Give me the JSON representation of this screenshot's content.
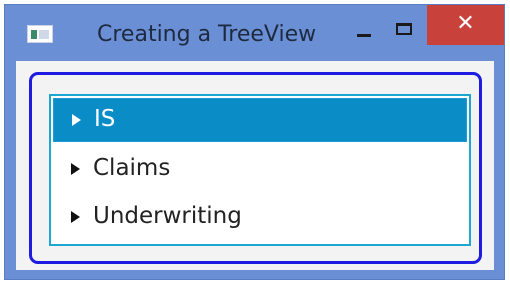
{
  "window": {
    "title": "Creating a TreeView",
    "close_glyph": "✕",
    "icons": {
      "app": "window-app-icon",
      "minimize": "minimize-icon",
      "maximize": "maximize-icon",
      "close": "close-icon"
    }
  },
  "tree": {
    "items": [
      {
        "label": "IS",
        "selected": true,
        "expander_icon": "expand-arrow-icon"
      },
      {
        "label": "Claims",
        "selected": false,
        "expander_icon": "expand-arrow-icon"
      },
      {
        "label": "Underwriting",
        "selected": false,
        "expander_icon": "expand-arrow-icon"
      }
    ]
  },
  "colors": {
    "window_frame": "#6b8fd4",
    "close_button": "#c8413a",
    "selection": "#0a8cc6",
    "focus_outline": "#1d1ce0",
    "tree_border": "#1ba7d1"
  }
}
